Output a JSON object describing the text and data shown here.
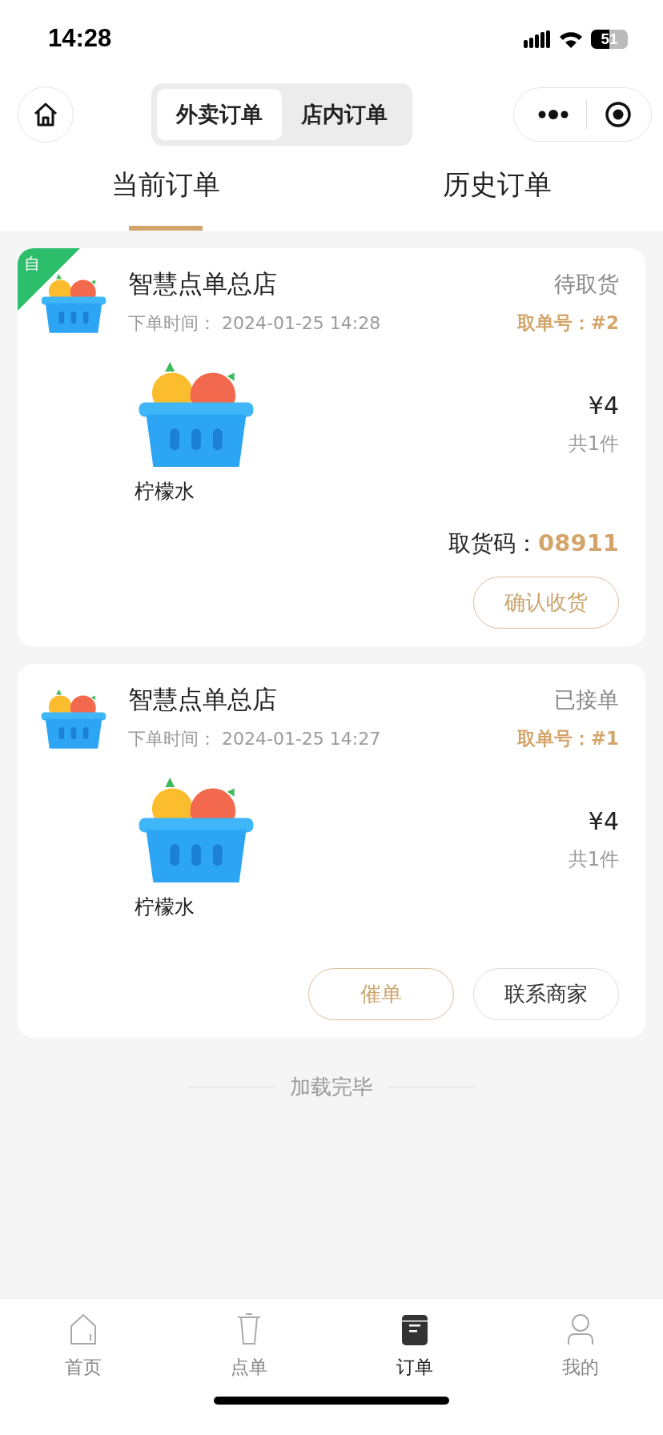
{
  "status_bar": {
    "time": "14:28",
    "battery": "51"
  },
  "header": {
    "segments": [
      {
        "label": "外卖订单",
        "selected": true
      },
      {
        "label": "店内订单",
        "selected": false
      }
    ]
  },
  "tabs": [
    {
      "label": "当前订单",
      "selected": true
    },
    {
      "label": "历史订单",
      "selected": false
    }
  ],
  "orders": [
    {
      "badge": "自",
      "store": "智慧点单总店",
      "status": "待取货",
      "time_label": "下单时间：",
      "time": "2024-01-25 14:28",
      "ticket": "取单号：#2",
      "items": [
        {
          "name": "柠檬水",
          "price": "¥4",
          "count": "共1件"
        }
      ],
      "pickup_code": {
        "label": "取货码：",
        "value": "08911"
      },
      "actions": [
        {
          "label": "确认收货",
          "kind": "primary"
        }
      ]
    },
    {
      "store": "智慧点单总店",
      "status": "已接单",
      "time_label": "下单时间：",
      "time": "2024-01-25 14:27",
      "ticket": "取单号：#1",
      "items": [
        {
          "name": "柠檬水",
          "price": "¥4",
          "count": "共1件"
        }
      ],
      "actions": [
        {
          "label": "催单",
          "kind": "primary"
        },
        {
          "label": "联系商家",
          "kind": "default"
        }
      ]
    }
  ],
  "footer": "加载完毕",
  "bottom_nav": [
    {
      "label": "首页",
      "kind": "home",
      "selected": false
    },
    {
      "label": "点单",
      "kind": "cup",
      "selected": false
    },
    {
      "label": "订单",
      "kind": "order",
      "selected": true
    },
    {
      "label": "我的",
      "kind": "user",
      "selected": false
    }
  ]
}
